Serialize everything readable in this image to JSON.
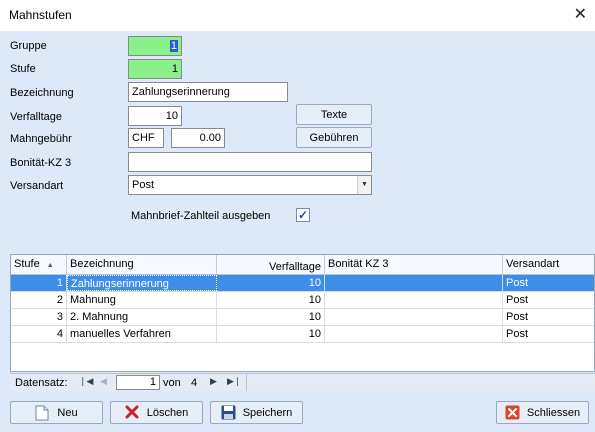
{
  "window": {
    "title": "Mahnstufen"
  },
  "form": {
    "gruppe_label": "Gruppe",
    "gruppe_value": "1",
    "stufe_label": "Stufe",
    "stufe_value": "1",
    "bezeichnung_label": "Bezeichnung",
    "bezeichnung_value": "Zahlungserinnerung",
    "verfalltage_label": "Verfalltage",
    "verfalltage_value": "10",
    "mahngebuehr_label": "Mahngebühr",
    "mahngebuehr_currency": "CHF",
    "mahngebuehr_amount": "0.00",
    "bonitaet_label": "Bonität-KZ 3",
    "bonitaet_value": "",
    "versandart_label": "Versandart",
    "versandart_value": "Post",
    "zahlteil_label": "Mahnbrief-Zahlteil ausgeben",
    "zahlteil_checked": true,
    "texte_label": "Texte",
    "gebuehren_label": "Gebühren"
  },
  "grid": {
    "columns": [
      "Stufe",
      "Bezeichnung",
      "Verfalltage",
      "Bonität KZ 3",
      "Versandart"
    ],
    "rows": [
      {
        "stufe": "1",
        "bezeichnung": "Zahlungserinnerung",
        "verfalltage": "10",
        "bonitaet": "",
        "versandart": "Post"
      },
      {
        "stufe": "2",
        "bezeichnung": "Mahnung",
        "verfalltage": "10",
        "bonitaet": "",
        "versandart": "Post"
      },
      {
        "stufe": "3",
        "bezeichnung": "2. Mahnung",
        "verfalltage": "10",
        "bonitaet": "",
        "versandart": "Post"
      },
      {
        "stufe": "4",
        "bezeichnung": "manuelles Verfahren",
        "verfalltage": "10",
        "bonitaet": "",
        "versandart": "Post"
      }
    ],
    "selected_row": 0
  },
  "navigator": {
    "label": "Datensatz:",
    "current": "1",
    "of_label": "von",
    "total": "4"
  },
  "footer": {
    "neu_label": "Neu",
    "loeschen_label": "Löschen",
    "speichern_label": "Speichern",
    "schliessen_label": "Schliessen"
  },
  "colors": {
    "accent_green": "#8af08a",
    "selection_blue": "#3d8ee9",
    "client_bg": "#dde8f8",
    "delete_red": "#c8202a",
    "close_red": "#d9442c"
  },
  "icons": {
    "neu": "new-document-icon",
    "loeschen": "delete-x-icon",
    "speichern": "floppy-disk-icon",
    "schliessen": "close-x-icon",
    "close": "close-icon",
    "sort": "sort-ascending-icon"
  }
}
